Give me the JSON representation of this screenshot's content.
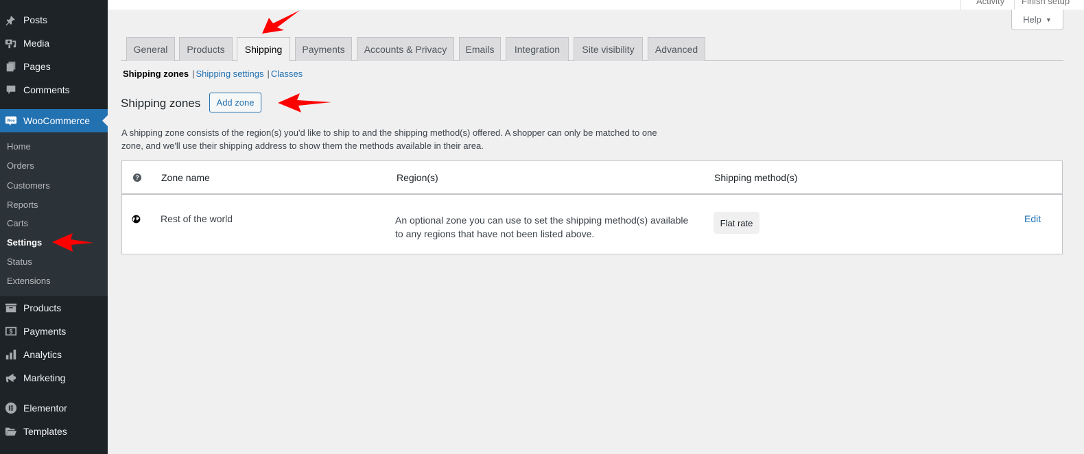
{
  "sidebar": {
    "items": [
      {
        "label": "Posts",
        "icon": "pushpin-icon"
      },
      {
        "label": "Media",
        "icon": "media-icon"
      },
      {
        "label": "Pages",
        "icon": "pages-icon"
      },
      {
        "label": "Comments",
        "icon": "comment-icon"
      },
      {
        "label": "WooCommerce",
        "icon": "woo-icon",
        "current": true
      },
      {
        "label": "Products",
        "icon": "archive-icon"
      },
      {
        "label": "Payments",
        "icon": "dollar-icon"
      },
      {
        "label": "Analytics",
        "icon": "bar-chart-icon"
      },
      {
        "label": "Marketing",
        "icon": "megaphone-icon"
      },
      {
        "label": "Elementor",
        "icon": "elementor-icon"
      },
      {
        "label": "Templates",
        "icon": "folder-open-icon"
      }
    ],
    "woo_submenu": [
      {
        "label": "Home"
      },
      {
        "label": "Orders"
      },
      {
        "label": "Customers"
      },
      {
        "label": "Reports"
      },
      {
        "label": "Carts"
      },
      {
        "label": "Settings",
        "current": true
      },
      {
        "label": "Status"
      },
      {
        "label": "Extensions"
      }
    ],
    "woo_icon_text": "Woo"
  },
  "topbar": {
    "activity_label": "Activity",
    "finish_setup_label": "Finish setup",
    "help_label": "Help",
    "help_caret": "▼"
  },
  "tabs": [
    {
      "label": "General"
    },
    {
      "label": "Products"
    },
    {
      "label": "Shipping",
      "active": true
    },
    {
      "label": "Payments"
    },
    {
      "label": "Accounts & Privacy"
    },
    {
      "label": "Emails"
    },
    {
      "label": "Integration"
    },
    {
      "label": "Site visibility"
    },
    {
      "label": "Advanced"
    }
  ],
  "subnav": {
    "current": "Shipping zones",
    "links": [
      "Shipping settings",
      "Classes"
    ],
    "separator": "|"
  },
  "page": {
    "heading": "Shipping zones",
    "add_zone_label": "Add zone",
    "intro": "A shipping zone consists of the region(s) you'd like to ship to and the shipping method(s) offered. A shopper can only be matched to one zone, and we'll use their shipping address to show them the methods available in their area."
  },
  "table": {
    "help_glyph": "?",
    "headers": {
      "zone_name": "Zone name",
      "regions": "Region(s)",
      "methods": "Shipping method(s)"
    },
    "rows": [
      {
        "zone_name": "Rest of the world",
        "regions": "An optional zone you can use to set the shipping method(s) available to any regions that have not been listed above.",
        "methods": [
          "Flat rate"
        ],
        "action": "Edit"
      }
    ]
  },
  "colors": {
    "accent": "#2271b1",
    "sidebar_bg": "#1d2327",
    "submenu_bg": "#2c3338",
    "annotation_arrow": "#ff0000"
  }
}
